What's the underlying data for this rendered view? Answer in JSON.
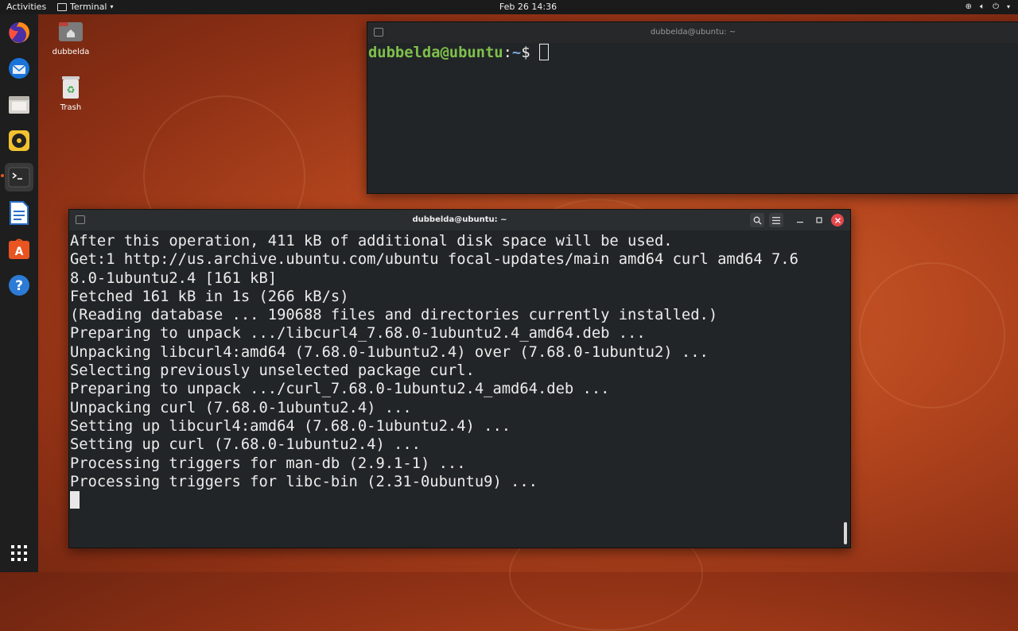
{
  "topbar": {
    "activities": "Activities",
    "app_name": "Terminal",
    "clock": "Feb 26  14:36"
  },
  "dock": {
    "items": [
      "firefox-icon",
      "thunderbird-icon",
      "files-icon",
      "rhythmbox-icon",
      "terminal-icon",
      "libreoffice-writer-icon",
      "software-icon",
      "help-icon"
    ],
    "apps_grid": "show-applications-icon"
  },
  "desktop": {
    "home_label": "dubbelda",
    "trash_label": "Trash"
  },
  "colors": {
    "accent": "#e95420",
    "prompt_user": "#7ec04b",
    "prompt_path": "#7aa6da",
    "close_button": "#e2474b"
  },
  "back_window": {
    "title": "dubbelda@ubuntu: ~",
    "prompt_user": "dubbelda@ubuntu",
    "prompt_sep": ":",
    "prompt_path": "~",
    "prompt_symbol": "$ "
  },
  "front_window": {
    "title": "dubbelda@ubuntu: ~",
    "lines": [
      "After this operation, 411 kB of additional disk space will be used.",
      "Get:1 http://us.archive.ubuntu.com/ubuntu focal-updates/main amd64 curl amd64 7.6",
      "8.0-1ubuntu2.4 [161 kB]",
      "Fetched 161 kB in 1s (266 kB/s)",
      "(Reading database ... 190688 files and directories currently installed.)",
      "Preparing to unpack .../libcurl4_7.68.0-1ubuntu2.4_amd64.deb ...",
      "Unpacking libcurl4:amd64 (7.68.0-1ubuntu2.4) over (7.68.0-1ubuntu2) ...",
      "Selecting previously unselected package curl.",
      "Preparing to unpack .../curl_7.68.0-1ubuntu2.4_amd64.deb ...",
      "Unpacking curl (7.68.0-1ubuntu2.4) ...",
      "Setting up libcurl4:amd64 (7.68.0-1ubuntu2.4) ...",
      "Setting up curl (7.68.0-1ubuntu2.4) ...",
      "Processing triggers for man-db (2.9.1-1) ...",
      "Processing triggers for libc-bin (2.31-0ubuntu9) ..."
    ]
  }
}
